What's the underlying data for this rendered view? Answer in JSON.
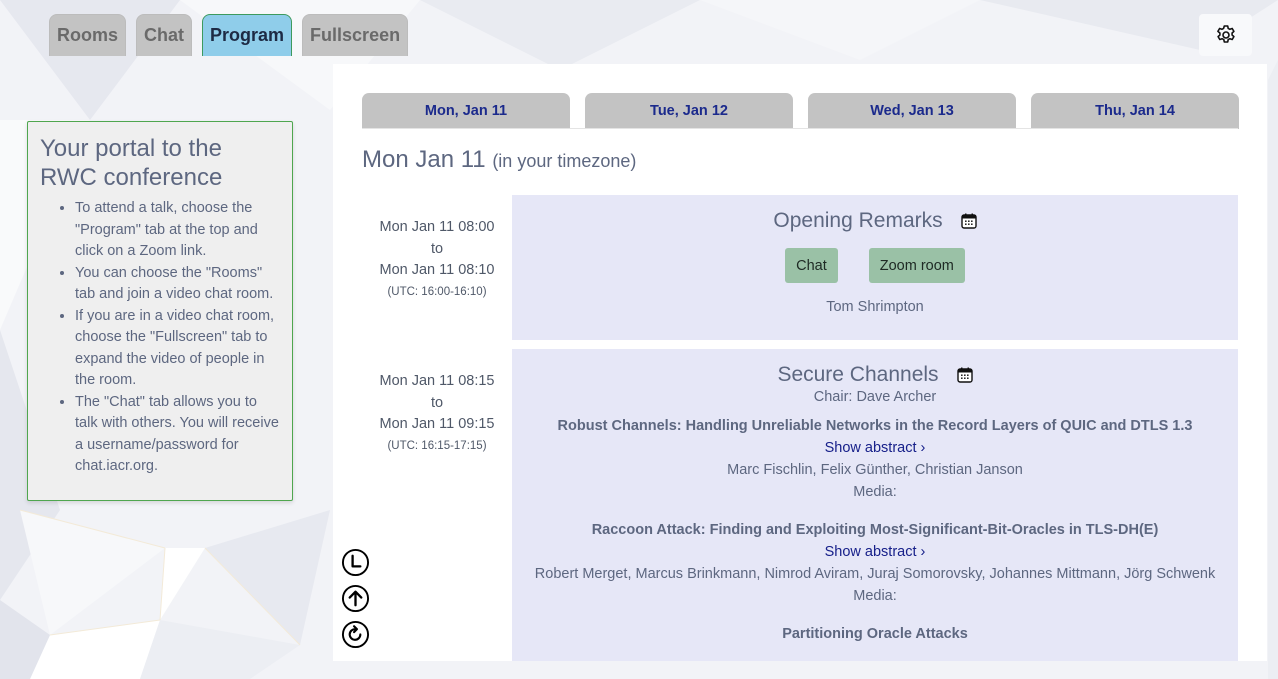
{
  "nav": {
    "tabs": [
      {
        "label": "Rooms",
        "active": false
      },
      {
        "label": "Chat",
        "active": false
      },
      {
        "label": "Program",
        "active": true
      },
      {
        "label": "Fullscreen",
        "active": false
      }
    ],
    "settings_icon": "gear-icon"
  },
  "info": {
    "title": "Your portal to the RWC conference",
    "items": [
      "To attend a talk, choose the \"Program\" tab at the top and click on a Zoom link.",
      "You can choose the \"Rooms\" tab and join a video chat room.",
      "If you are in a video chat room, choose the \"Fullscreen\" tab to expand the video of people in the room.",
      "The \"Chat\" tab allows you to talk with others. You will receive a username/password for chat.iacr.org."
    ]
  },
  "program": {
    "day_tabs": [
      "Mon, Jan 11",
      "Tue, Jan 12",
      "Wed, Jan 13",
      "Thu, Jan 14"
    ],
    "heading": "Mon Jan 11",
    "heading_sub": "(in your timezone)",
    "sessions": [
      {
        "start": "Mon Jan 11 08:00",
        "to": "to",
        "end": "Mon Jan 11 08:10",
        "utc": "(UTC: 16:00-16:10)",
        "title": "Opening Remarks",
        "buttons": [
          "Chat",
          "Zoom room"
        ],
        "speaker": "Tom Shrimpton"
      },
      {
        "start": "Mon Jan 11 08:15",
        "to": "to",
        "end": "Mon Jan 11 09:15",
        "utc": "(UTC: 16:15-17:15)",
        "title": "Secure Channels",
        "chair": "Chair: Dave Archer",
        "talks": [
          {
            "title": "Robust Channels: Handling Unreliable Networks in the Record Layers of QUIC and DTLS 1.3",
            "abstract_link": "Show abstract ›",
            "authors": "Marc Fischlin, Felix Günther, Christian Janson",
            "media": "Media:"
          },
          {
            "title": "Raccoon Attack: Finding and Exploiting Most-Significant-Bit-Oracles in TLS-DH(E)",
            "abstract_link": "Show abstract ›",
            "authors": "Robert Merget, Marcus Brinkmann, Nimrod Aviram, Juraj Somorovsky, Johannes Mittmann, Jörg Schwenk",
            "media": "Media:"
          },
          {
            "title": "Partitioning Oracle Attacks"
          }
        ]
      }
    ]
  },
  "float_icons": [
    "clock-icon",
    "arrow-up-icon",
    "refresh-icon"
  ]
}
